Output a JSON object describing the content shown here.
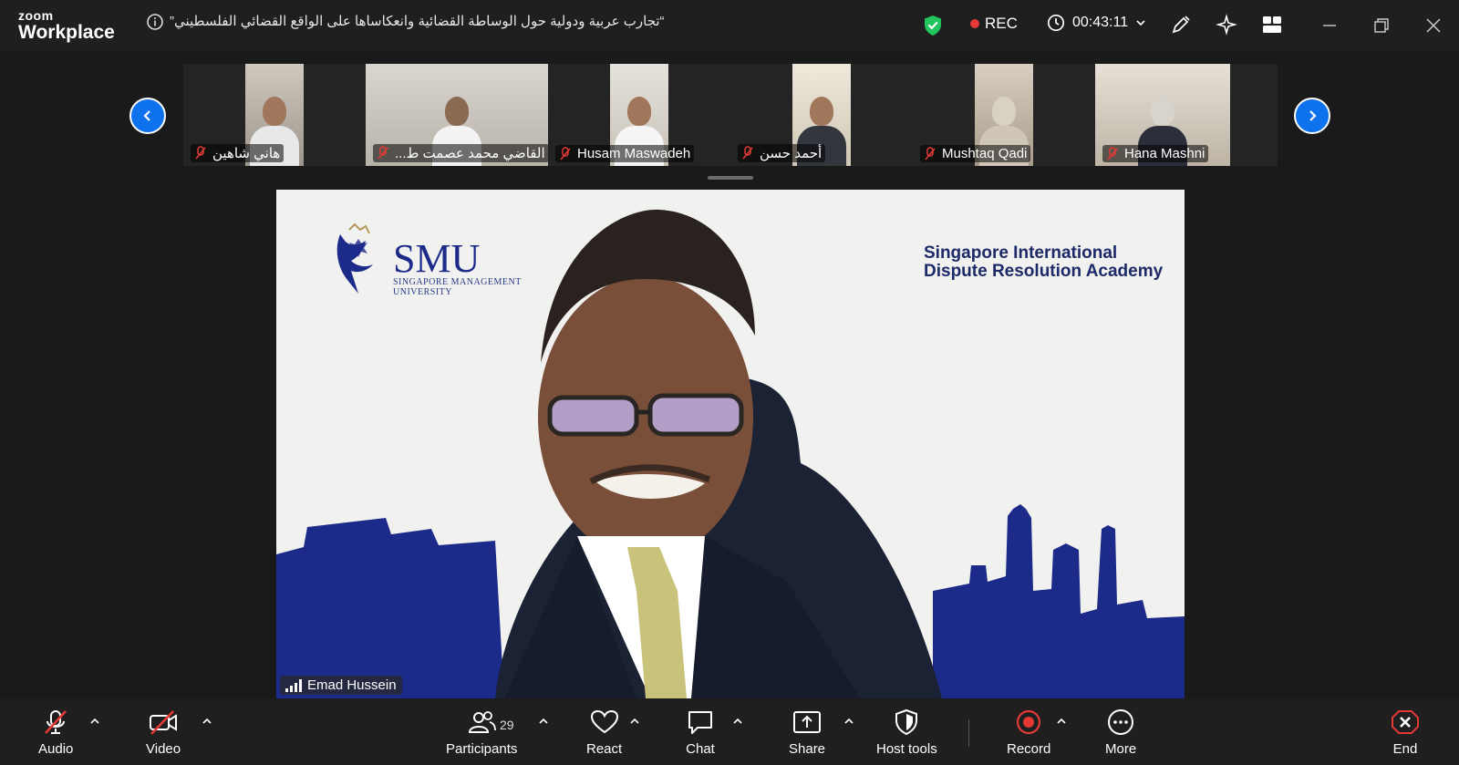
{
  "app": {
    "logo_top": "zoom",
    "logo_bottom": "Workplace"
  },
  "meeting": {
    "title": "“تجارب عربية ودولية حول الوساطة القضائية وانعكاساها على الواقع القضائي الفلسطيني”",
    "recording_label": "REC",
    "elapsed": "00:43:11"
  },
  "participants_strip": [
    {
      "name": "هاني شاهين",
      "muted": true
    },
    {
      "name": "القاضي محمد عصمت ط...",
      "muted": true
    },
    {
      "name": "Husam Maswadeh",
      "muted": true
    },
    {
      "name": "أحمد حسن",
      "muted": true
    },
    {
      "name": "Mushtaq Qadi",
      "muted": true
    },
    {
      "name": "Hana Mashni",
      "muted": true
    }
  ],
  "active_speaker": {
    "name": "Emad Hussein",
    "background": {
      "logo_text": "SMU",
      "logo_subtitle_1": "SINGAPORE MANAGEMENT",
      "logo_subtitle_2": "UNIVERSITY",
      "academy_line_1": "Singapore International",
      "academy_line_2": "Dispute Resolution Academy"
    }
  },
  "toolbar": {
    "audio": "Audio",
    "video": "Video",
    "participants": "Participants",
    "participants_count": "29",
    "react": "React",
    "chat": "Chat",
    "share": "Share",
    "host_tools": "Host tools",
    "record": "Record",
    "more": "More",
    "end": "End"
  },
  "colors": {
    "accent_blue": "#0e72ed",
    "record_red": "#e53935",
    "secure_green": "#22c55e",
    "brand_navy": "#1c2a8a"
  }
}
